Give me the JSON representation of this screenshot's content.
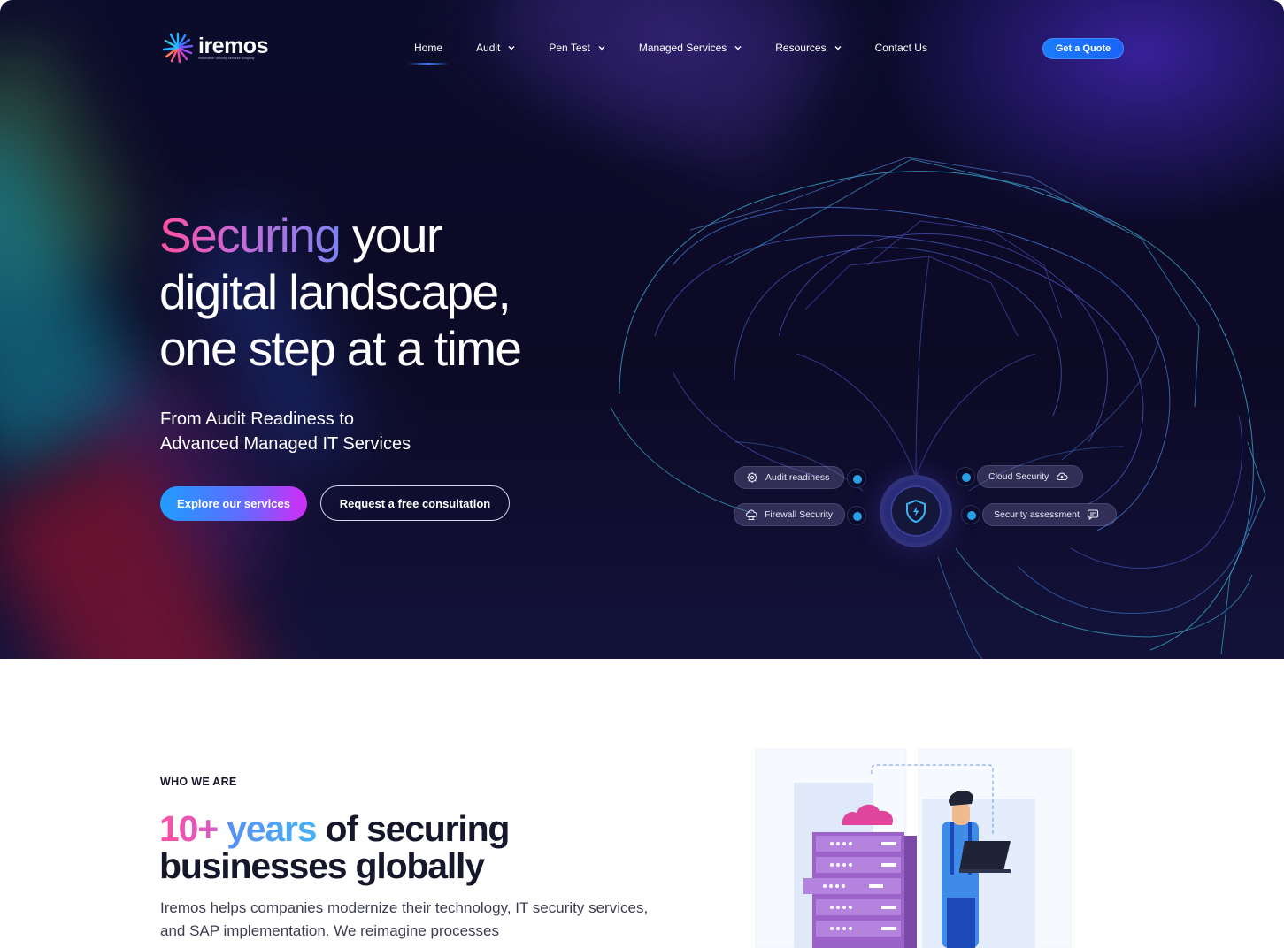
{
  "brand": {
    "name": "iremos",
    "tagline": "information Security services company"
  },
  "nav": {
    "items": [
      {
        "label": "Home",
        "active": true
      },
      {
        "label": "Audit",
        "dropdown": true
      },
      {
        "label": "Pen Test",
        "dropdown": true
      },
      {
        "label": "Managed Services",
        "dropdown": true
      },
      {
        "label": "Resources",
        "dropdown": true
      },
      {
        "label": "Contact Us"
      }
    ],
    "cta_label": "Get a Quote"
  },
  "hero": {
    "headline_highlight": "Securing",
    "headline_rest_1": " your",
    "headline_line_2": "digital landscape,",
    "headline_line_3": "one step at a time",
    "subhead_line_1": "From Audit Readiness to",
    "subhead_line_2": "Advanced Managed IT Services",
    "primary_button": "Explore our services",
    "secondary_button": "Request a free consultation",
    "features": [
      {
        "label": "Audit readiness",
        "icon": "gear-shield-icon"
      },
      {
        "label": "Firewall Security",
        "icon": "cloud-firewall-icon"
      },
      {
        "label": "Cloud Security",
        "icon": "cloud-upload-icon"
      },
      {
        "label": "Security assessment",
        "icon": "chat-check-icon"
      }
    ]
  },
  "who": {
    "label": "WHO WE ARE",
    "title_num": "10+",
    "title_years": " years",
    "title_rest_1": " of securing",
    "title_line_2": "businesses globally",
    "body": "Iremos helps companies modernize their technology, IT security services, and SAP implementation. We reimagine processes"
  },
  "colors": {
    "hero_bg": "#0c0a25",
    "accent_blue": "#1a7cff",
    "accent_pink": "#ff4fa2",
    "accent_purple": "#d22cf6",
    "feature_dot": "#27a0e6"
  }
}
